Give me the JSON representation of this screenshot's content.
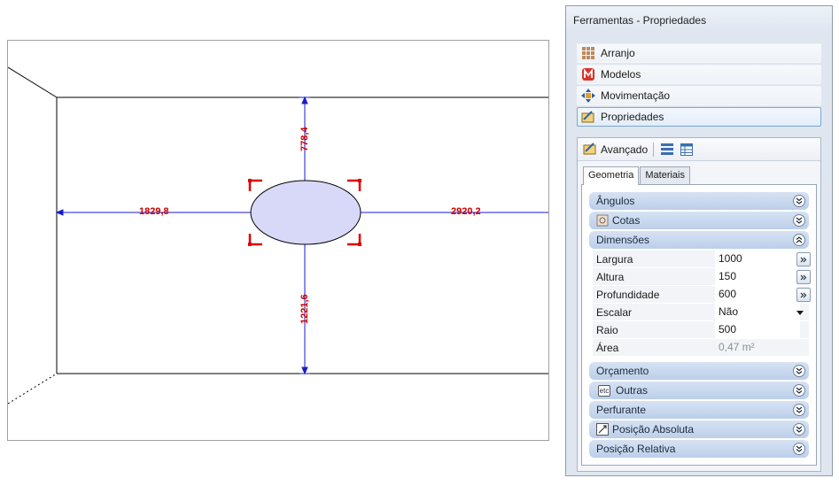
{
  "viewport": {
    "dim_left": "1829,8",
    "dim_right": "2920,2",
    "dim_top": "778,4",
    "dim_bottom": "1221,6",
    "colors": {
      "dimension": "#1a1acc",
      "label": "#cc0000",
      "shape_fill": "#d8d8f8",
      "selection": "#e00000"
    }
  },
  "panel": {
    "title": "Ferramentas - Propriedades",
    "categories": [
      {
        "label": "Arranjo",
        "icon": "grid-icon"
      },
      {
        "label": "Modelos",
        "icon": "m-logo-icon"
      },
      {
        "label": "Movimentação",
        "icon": "move-icon"
      },
      {
        "label": "Propriedades",
        "icon": "properties-icon"
      }
    ],
    "toolbar": {
      "label": "Avançado"
    },
    "tabs": [
      "Geometria",
      "Materiais"
    ],
    "groups": {
      "angulos": "Ângulos",
      "cotas": "Cotas",
      "dimensoes": "Dimensões",
      "orcamento": "Orçamento",
      "outras": "Outras",
      "outras_icon_text": "etc",
      "perfurante": "Perfurante",
      "posicao_absoluta": "Posição Absoluta",
      "posicao_relativa": "Posição Relativa"
    },
    "properties": [
      {
        "label": "Largura",
        "value": "1000"
      },
      {
        "label": "Altura",
        "value": "150"
      },
      {
        "label": "Profundidade",
        "value": "600"
      },
      {
        "label": "Escalar",
        "value": "Não"
      },
      {
        "label": "Raio",
        "value": "500"
      },
      {
        "label": "Área",
        "value": "0,47 m²"
      }
    ]
  }
}
